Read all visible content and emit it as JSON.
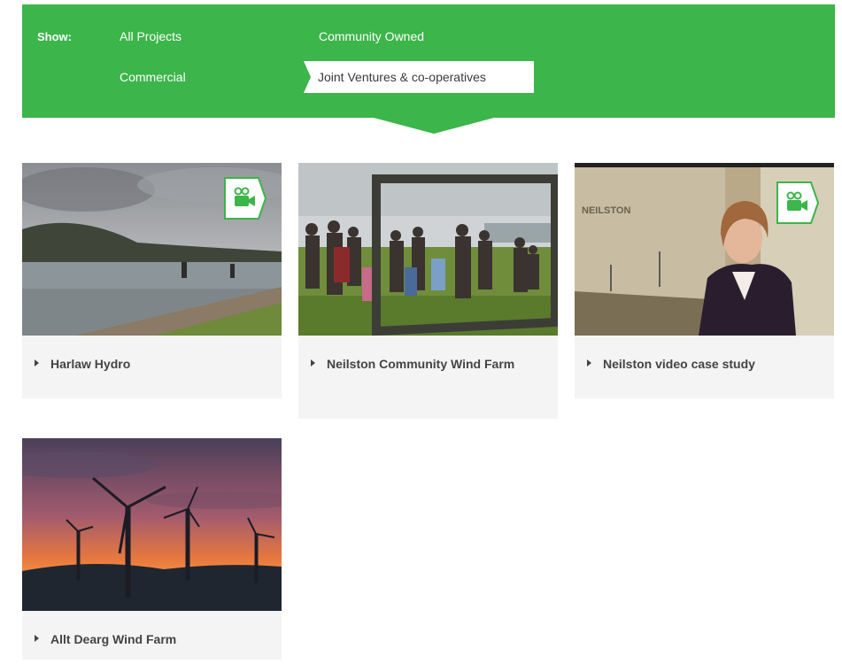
{
  "filter": {
    "show_label": "Show:",
    "options": [
      {
        "label": "All Projects",
        "selected": false
      },
      {
        "label": "Community Owned",
        "selected": false
      },
      {
        "label": "Commercial",
        "selected": false
      },
      {
        "label": "Joint Ventures & co-operatives",
        "selected": true
      }
    ]
  },
  "colors": {
    "accent": "#3cb54a",
    "card_bg": "#f4f4f4",
    "caption_text": "#444444"
  },
  "cards": [
    {
      "title": "Harlaw Hydro",
      "has_video": true,
      "image": "reservoir landscape"
    },
    {
      "title": "Neilston Community Wind Farm",
      "has_video": false,
      "image": "crowd behind frame"
    },
    {
      "title": "Neilston video case study",
      "has_video": true,
      "image": "woman speaking"
    },
    {
      "title": "Allt Dearg Wind Farm",
      "has_video": false,
      "image": "wind turbines at sunset"
    }
  ],
  "sign_text": "NEILSTON",
  "icons": {
    "video": "video-camera-icon",
    "bullet": "caret-right-icon"
  }
}
